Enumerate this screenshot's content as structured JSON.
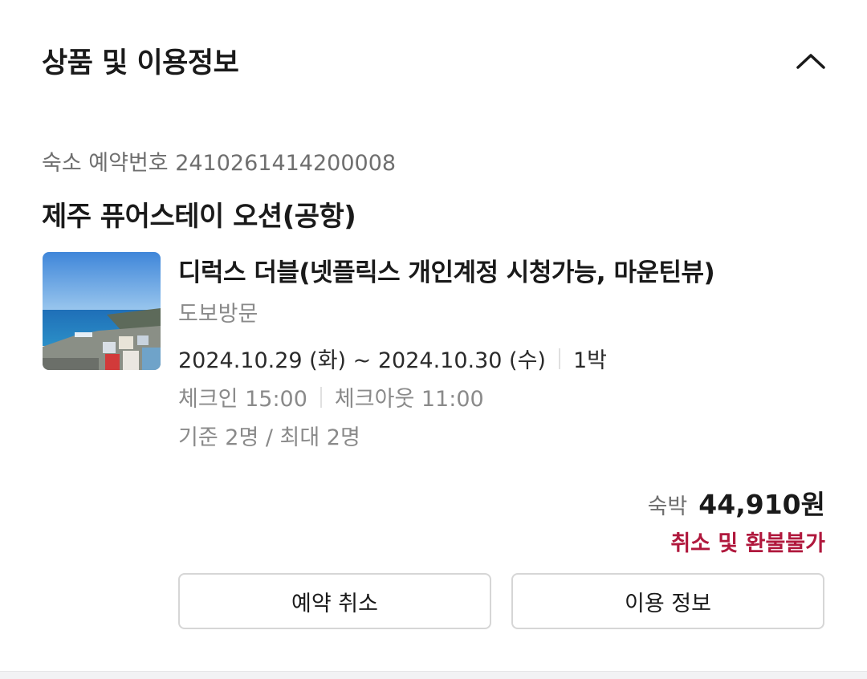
{
  "section": {
    "title": "상품 및 이용정보",
    "toggle_icon": "chevron-up-icon"
  },
  "reservation": {
    "number_text": "숙소 예약번호 2410261414200008"
  },
  "hotel": {
    "name": "제주 퓨어스테이 오션(공항)"
  },
  "room": {
    "thumbnail_icon": "room-photo-ocean-view",
    "name": "디럭스 더블(넷플릭스 개인계정 시청가능, 마운틴뷰)",
    "visit_type": "도보방문",
    "date_range": "2024.10.29 (화) ~ 2024.10.30 (수)",
    "nights": "1박",
    "checkin": "체크인 15:00",
    "checkout": "체크아웃 11:00",
    "occupancy": "기준 2명 / 최대 2명"
  },
  "price": {
    "label": "숙박",
    "value": "44,910원"
  },
  "refund": {
    "note": "취소 및 환불불가",
    "color": "#b0183d"
  },
  "actions": {
    "cancel_label": "예약 취소",
    "info_label": "이용 정보"
  }
}
